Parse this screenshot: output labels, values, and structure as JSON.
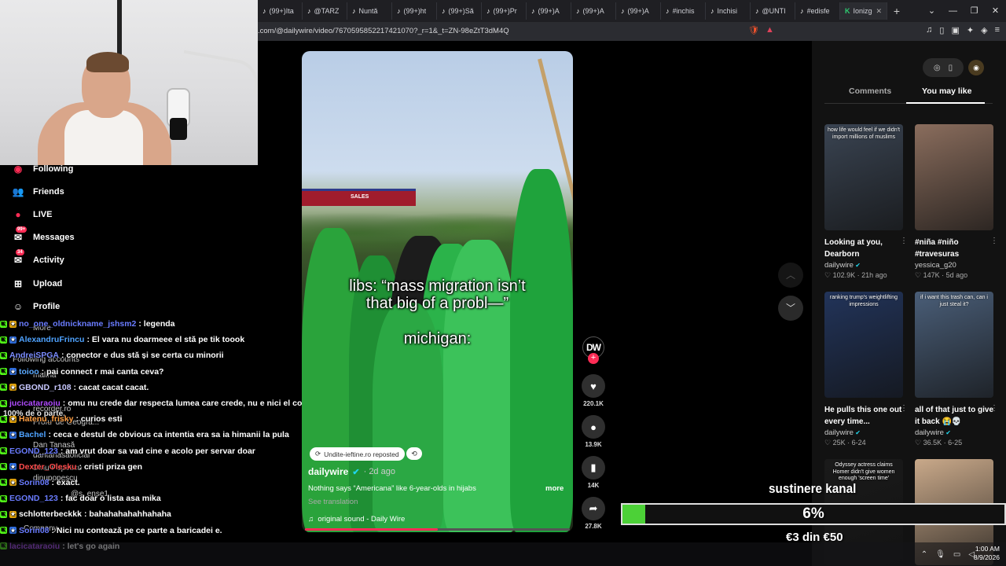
{
  "browser": {
    "tabs": [
      {
        "label": "(99+)Ita",
        "icon": "tiktok"
      },
      {
        "label": "@TARZ",
        "icon": "tiktok"
      },
      {
        "label": "Nuntă",
        "icon": "tiktok"
      },
      {
        "label": "(99+)ht",
        "icon": "tiktok"
      },
      {
        "label": "(99+)Să",
        "icon": "tiktok"
      },
      {
        "label": "(99+)Pr",
        "icon": "tiktok"
      },
      {
        "label": "(99+)A",
        "icon": "tiktok"
      },
      {
        "label": "(99+)A",
        "icon": "tiktok"
      },
      {
        "label": "(99+)A",
        "icon": "tiktok"
      },
      {
        "label": "#inchis",
        "icon": "tiktok"
      },
      {
        "label": "Inchisi",
        "icon": "tiktok"
      },
      {
        "label": "@UNTI",
        "icon": "tiktok"
      },
      {
        "label": "#edisfe",
        "icon": "tiktok"
      },
      {
        "label": "Ionizgo",
        "icon": "green-k"
      }
    ],
    "url": ".com/@dailywire/video/7670595852217421070?_r=1&_t=ZN-98eZtT3dM4Q"
  },
  "sidebar": {
    "items": [
      {
        "label": "Following",
        "icon": "following-avatar-icon"
      },
      {
        "label": "Friends",
        "icon": "friends-icon"
      },
      {
        "label": "LIVE",
        "icon": "live-icon"
      },
      {
        "label": "Messages",
        "icon": "messages-icon",
        "badge": "99+"
      },
      {
        "label": "Activity",
        "icon": "activity-icon",
        "badge": "34"
      },
      {
        "label": "Upload",
        "icon": "upload-icon"
      },
      {
        "label": "Profile",
        "icon": "profile-icon"
      }
    ]
  },
  "chat": [
    {
      "user": "no_one_oldnickname_jshsm2",
      "msg": ": legenda",
      "color": "#6a7cff"
    },
    {
      "user": "AlexandruFrincu",
      "msg": ": El vara nu doarmeee el stă pe tik toook",
      "color": "#4fa3ff"
    },
    {
      "user": "AndreiSPGA",
      "msg": ": conector e dus stă și se certa cu minorii",
      "color": "#7b8cff"
    },
    {
      "user": "toioo",
      "msg": ": pai connect r mai canta ceva?",
      "color": "#5aa9ff"
    },
    {
      "user": "GBOND_r108",
      "msg": ": cacat cacat cacat.",
      "color": "#c8c8ff"
    },
    {
      "user": "jucicataraoiu",
      "msg": ": omu nu crede dar respecta lumea care crede, nu e nici el convins",
      "color": "#b04bff"
    },
    {
      "user": "Hatenu_frisky",
      "msg": ": curios esti",
      "color": "#ff9f43"
    },
    {
      "user": "Bachel",
      "msg": ": ceca e destul de obvious ca intentia era sa ia himanii la pula",
      "color": "#4fa3ff"
    },
    {
      "user": "EGOND_123",
      "msg": ": am vrut doar sa vad cine e acolo per servar doar",
      "color": "#6a7cff"
    },
    {
      "user": "Dexter_Olesku",
      "msg": ": cristi priza gen",
      "color": "#ff4b4b"
    },
    {
      "user": "Sorin08",
      "msg": ": exact.",
      "color": "#6a7cff"
    },
    {
      "user": "EGOND_123",
      "msg": ": fac doar o lista asa mika",
      "color": "#6a7cff"
    },
    {
      "user": "schlotterbeckkk",
      "msg": ": bahahahahahhahaha",
      "color": "#ffffff"
    },
    {
      "user": "Sorin08",
      "msg": ": Nici nu contează pe ce parte a baricadei e.",
      "color": "#6a7cff"
    },
    {
      "user": "lacicataraoiu",
      "msg": ": let's go again",
      "color": "#b04bff"
    }
  ],
  "ghost_text": {
    "more": "More",
    "following_accounts": "Following accounts",
    "malina": "malina",
    "recorder": "recorder.ro",
    "profu": "Profu' de Geogra...",
    "dantanasa": "Dan Tanasă",
    "dantanasaoficial": "dantanasaoficial",
    "dinu": "Dinu Popescu",
    "dinupopescu": "dinupopescu",
    "ense": "@s_ense1",
    "company": "Company",
    "hundred": "100% de o parte,"
  },
  "video": {
    "line1": "libs: “mass migration isn’t",
    "line2": "that big of a probl—”",
    "line3": "michigan:",
    "sign_text": "SALES",
    "repost_text": "Undite-ieftine.ro reposted",
    "author": "dailywire",
    "time": "2d ago",
    "description": "Nothing says “Americana” like 6-year-olds in hijabs",
    "more": "more",
    "see_translation": "See translation",
    "sound": "original sound - Daily Wire",
    "progress": 0.5
  },
  "actions": {
    "avatar": "DW",
    "likes": "220.1K",
    "comments": "13.9K",
    "saves": "14K",
    "shares": "27.8K"
  },
  "right_panel": {
    "tab_comments": "Comments",
    "tab_you_may_like": "You may like",
    "cards": [
      {
        "caption": "how life would feel if we didn't import millions of muslims",
        "title": "Looking at you, Dearborn",
        "author": "dailywire",
        "verified": true,
        "likes": "102.9K",
        "time": "21h ago",
        "color": "#3a4452"
      },
      {
        "caption": "",
        "title": "#niña #niño #travesuras",
        "author": "yessica_g20",
        "verified": false,
        "likes": "147K",
        "time": "5d ago",
        "color": "#8a6d5d"
      },
      {
        "caption": "ranking trump's weightlifting impressions",
        "title": "He pulls this one out every time...",
        "author": "dailywire",
        "verified": true,
        "likes": "25K",
        "time": "6-24",
        "color": "#22345a"
      },
      {
        "caption": "if i want this trash can, can i just steal it?",
        "title": "all of that just to give it back 😭💀",
        "author": "dailywire",
        "verified": true,
        "likes": "36.5K",
        "time": "6-25",
        "color": "#4a5e78"
      },
      {
        "caption": "Odyssey actress claims Homer didn't give women enough 'screen time'",
        "title": "",
        "author": "",
        "verified": false,
        "likes": "",
        "time": "",
        "color": "#1a1a1a"
      },
      {
        "caption": "",
        "title": "",
        "author": "",
        "verified": false,
        "likes": "",
        "time": "",
        "color": "#c9a98a"
      }
    ]
  },
  "donation": {
    "title": "sustinere kanal",
    "percent_label": "6%",
    "percent": 0.06,
    "amount": "€3 din €50"
  },
  "taskbar": {
    "time": "1:00 AM",
    "date": "8/9/2026"
  }
}
